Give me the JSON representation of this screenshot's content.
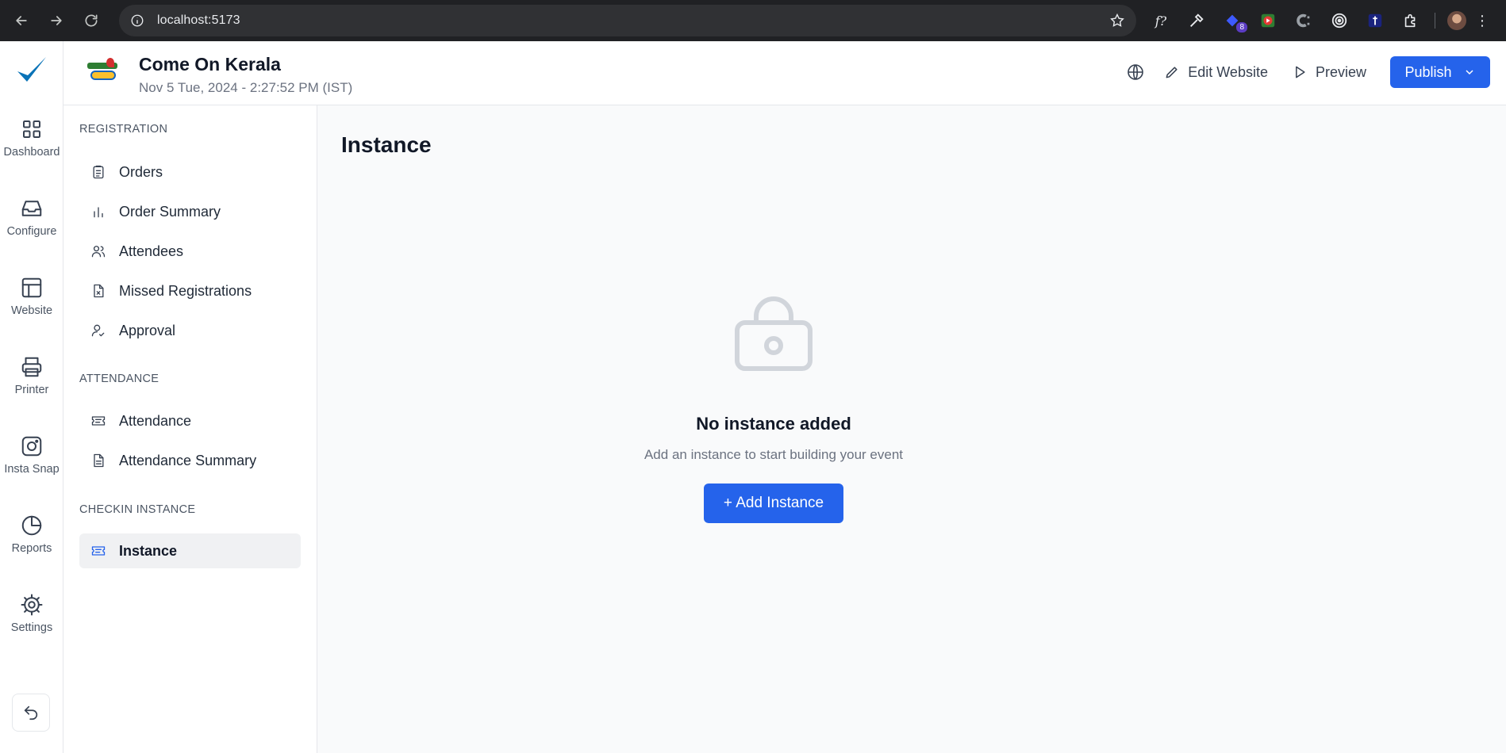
{
  "browser": {
    "url": "localhost:5173",
    "extension_badge": "8",
    "extensions": [
      "fx-icon",
      "eyedropper-icon",
      "extension-badge-icon",
      "youtube-icon",
      "c-extension-icon",
      "target-icon",
      "blue-extension-icon",
      "puzzle-icon"
    ]
  },
  "header": {
    "event_name": "Come On Kerala",
    "event_datetime": "Nov 5 Tue, 2024 - 2:27:52 PM (IST)",
    "edit_label": "Edit Website",
    "preview_label": "Preview",
    "publish_label": "Publish",
    "accent_color": "#2563eb"
  },
  "rail": {
    "items": [
      {
        "label": "Dashboard",
        "icon": "grid-icon"
      },
      {
        "label": "Configure",
        "icon": "inbox-icon"
      },
      {
        "label": "Website",
        "icon": "layout-icon"
      },
      {
        "label": "Printer",
        "icon": "printer-icon"
      },
      {
        "label": "Insta Snap",
        "icon": "instagram-icon"
      },
      {
        "label": "Reports",
        "icon": "pie-chart-icon"
      },
      {
        "label": "Settings",
        "icon": "cog-icon"
      }
    ]
  },
  "subnav": {
    "sections": [
      {
        "title": "REGISTRATION",
        "items": [
          {
            "label": "Orders",
            "icon": "clipboard-icon"
          },
          {
            "label": "Order Summary",
            "icon": "bar-chart-icon"
          },
          {
            "label": "Attendees",
            "icon": "users-icon"
          },
          {
            "label": "Missed Registrations",
            "icon": "file-x-icon"
          },
          {
            "label": "Approval",
            "icon": "user-check-icon"
          }
        ]
      },
      {
        "title": "ATTENDANCE",
        "items": [
          {
            "label": "Attendance",
            "icon": "ticket-icon"
          },
          {
            "label": "Attendance Summary",
            "icon": "file-text-icon"
          }
        ]
      },
      {
        "title": "CHECKIN INSTANCE",
        "items": [
          {
            "label": "Instance",
            "icon": "ticket-icon",
            "active": true
          }
        ]
      }
    ]
  },
  "main": {
    "title": "Instance",
    "empty_title": "No instance added",
    "empty_subtitle": "Add an instance to start building your event",
    "add_button": "+ Add Instance"
  }
}
